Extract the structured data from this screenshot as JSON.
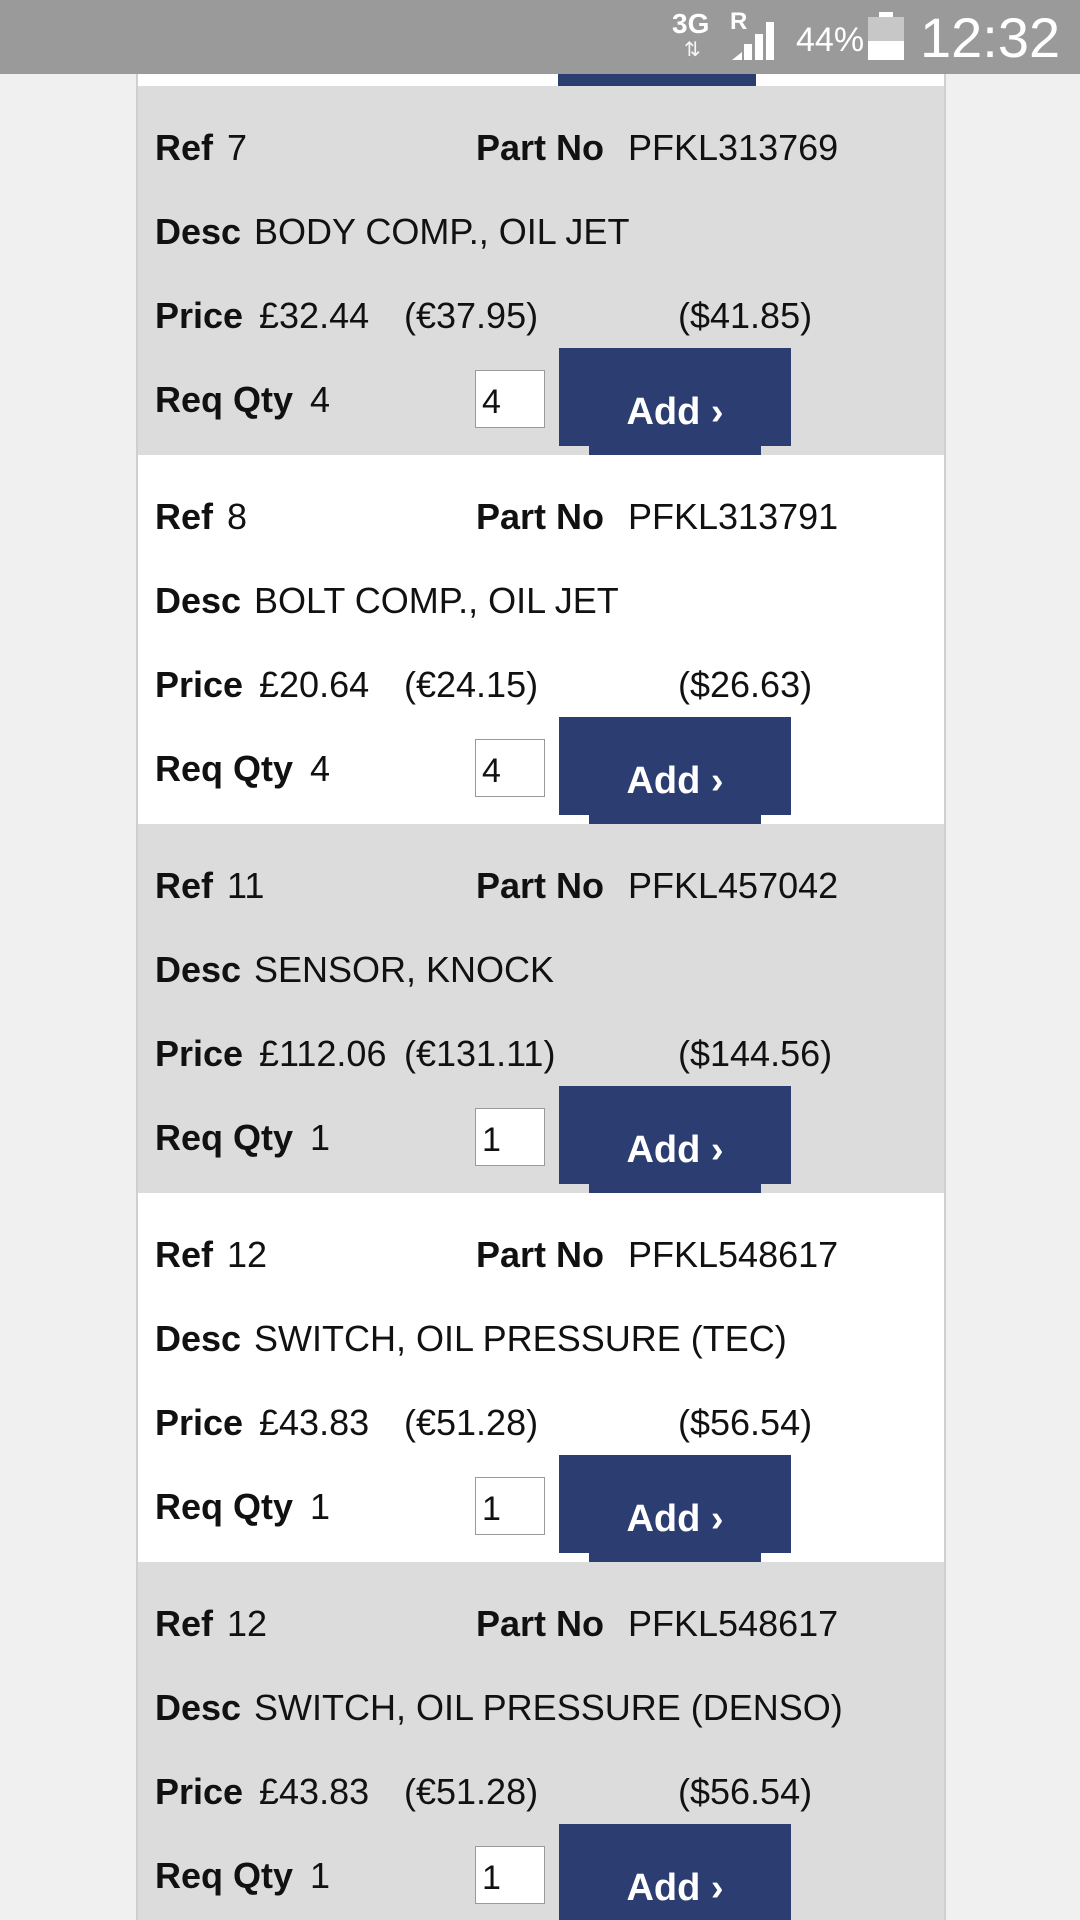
{
  "status_bar": {
    "network": "3G",
    "roaming": "R",
    "battery": "44%",
    "battery_level": 0.44,
    "time": "12:32"
  },
  "labels": {
    "ref": "Ref",
    "part_no": "Part No",
    "desc": "Desc",
    "price": "Price",
    "req_qty": "Req Qty",
    "add": "Add ›"
  },
  "parts": [
    {
      "ref": "7",
      "part_no": "PFKL313769",
      "desc": "BODY COMP., OIL JET",
      "price_gbp": "£32.44",
      "price_eur": "(€37.95)",
      "price_usd": "($41.85)",
      "req_qty": "4",
      "qty_value": "4"
    },
    {
      "ref": "8",
      "part_no": "PFKL313791",
      "desc": "BOLT COMP., OIL JET",
      "price_gbp": "£20.64",
      "price_eur": "(€24.15)",
      "price_usd": "($26.63)",
      "req_qty": "4",
      "qty_value": "4"
    },
    {
      "ref": "11",
      "part_no": "PFKL457042",
      "desc": "SENSOR, KNOCK",
      "price_gbp": "£112.06",
      "price_eur": "(€131.11)",
      "price_usd": "($144.56)",
      "req_qty": "1",
      "qty_value": "1"
    },
    {
      "ref": "12",
      "part_no": "PFKL548617",
      "desc": "SWITCH, OIL PRESSURE (TEC)",
      "price_gbp": "£43.83",
      "price_eur": "(€51.28)",
      "price_usd": "($56.54)",
      "req_qty": "1",
      "qty_value": "1"
    },
    {
      "ref": "12",
      "part_no": "PFKL548617",
      "desc": "SWITCH, OIL PRESSURE (DENSO)",
      "price_gbp": "£43.83",
      "price_eur": "(€51.28)",
      "price_usd": "($56.54)",
      "req_qty": "1",
      "qty_value": "1"
    }
  ],
  "colors": {
    "status_bar": "#9a9a9a",
    "row_grey": "#dcdcdc",
    "row_white": "#ffffff",
    "button": "#2b3d71"
  }
}
